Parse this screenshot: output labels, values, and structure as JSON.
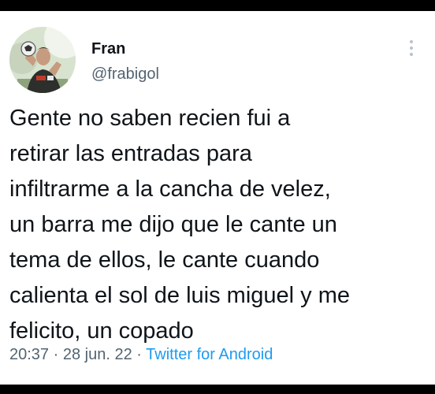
{
  "tweet": {
    "author": {
      "display_name": "Fran",
      "handle": "@frabigol",
      "avatar_icon": "profile-photo"
    },
    "more_icon": "more-vertical-icon",
    "text_lines": [
      "Gente no saben recien fui a",
      "retirar las entradas para",
      "infiltrarme a la cancha de velez,",
      "un barra me dijo que le cante un",
      "tema de ellos, le cante cuando",
      "calienta el sol de luis miguel y me",
      "felicito, un copado"
    ],
    "time": "20:37",
    "date": "28 jun. 22",
    "separator": "·",
    "source": "Twitter for Android"
  },
  "colors": {
    "text": "#0f1419",
    "secondary": "#536471",
    "link": "#1d9bf0",
    "background": "#ffffff"
  }
}
